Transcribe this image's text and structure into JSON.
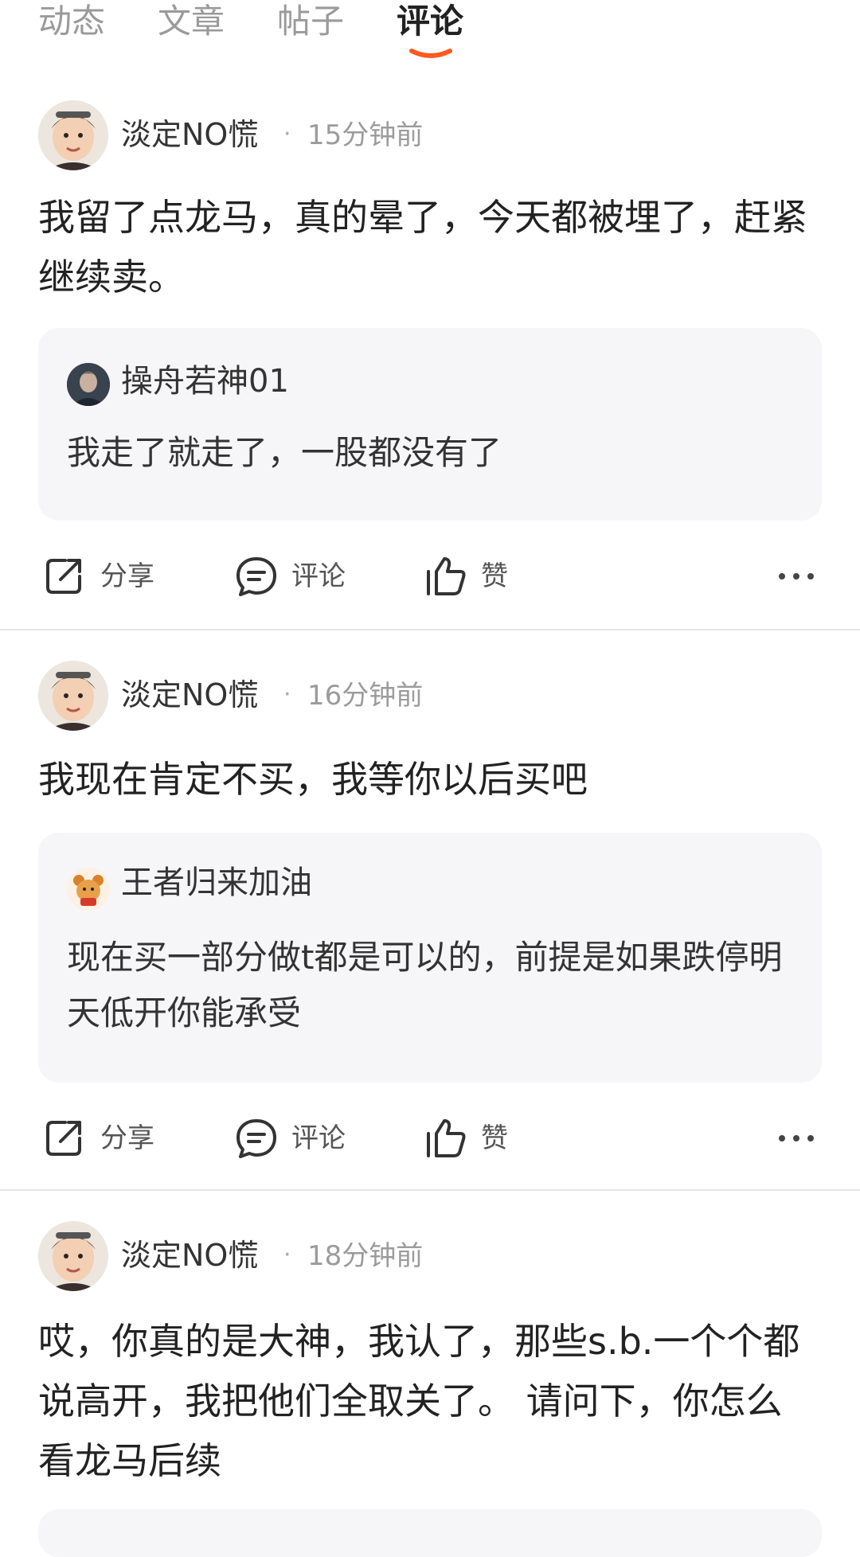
{
  "tabs": [
    {
      "label": "动态"
    },
    {
      "label": "文章"
    },
    {
      "label": "帖子"
    },
    {
      "label": "评论"
    }
  ],
  "active_tab_index": 3,
  "accent_color": "#FF5A1F",
  "actions": {
    "share": "分享",
    "comment": "评论",
    "like": "赞"
  },
  "posts": [
    {
      "author": "淡定NO慌",
      "separator": "·",
      "time": "15分钟前",
      "text": "我留了点龙马，真的晕了，今天都被埋了，赶紧继续卖。",
      "quote": {
        "author": "操舟若神01",
        "text": "我走了就走了，一股都没有了"
      }
    },
    {
      "author": "淡定NO慌",
      "separator": "·",
      "time": "16分钟前",
      "text": "我现在肯定不买，我等你以后买吧",
      "quote": {
        "author": "王者归来加油",
        "text": "现在买一部分做t都是可以的，前提是如果跌停明天低开你能承受"
      }
    },
    {
      "author": "淡定NO慌",
      "separator": "·",
      "time": "18分钟前",
      "text": "哎，你真的是大神，我认了，那些s.b.一个个都说高开，我把他们全取关了。 请问下，你怎么看龙马后续"
    }
  ]
}
